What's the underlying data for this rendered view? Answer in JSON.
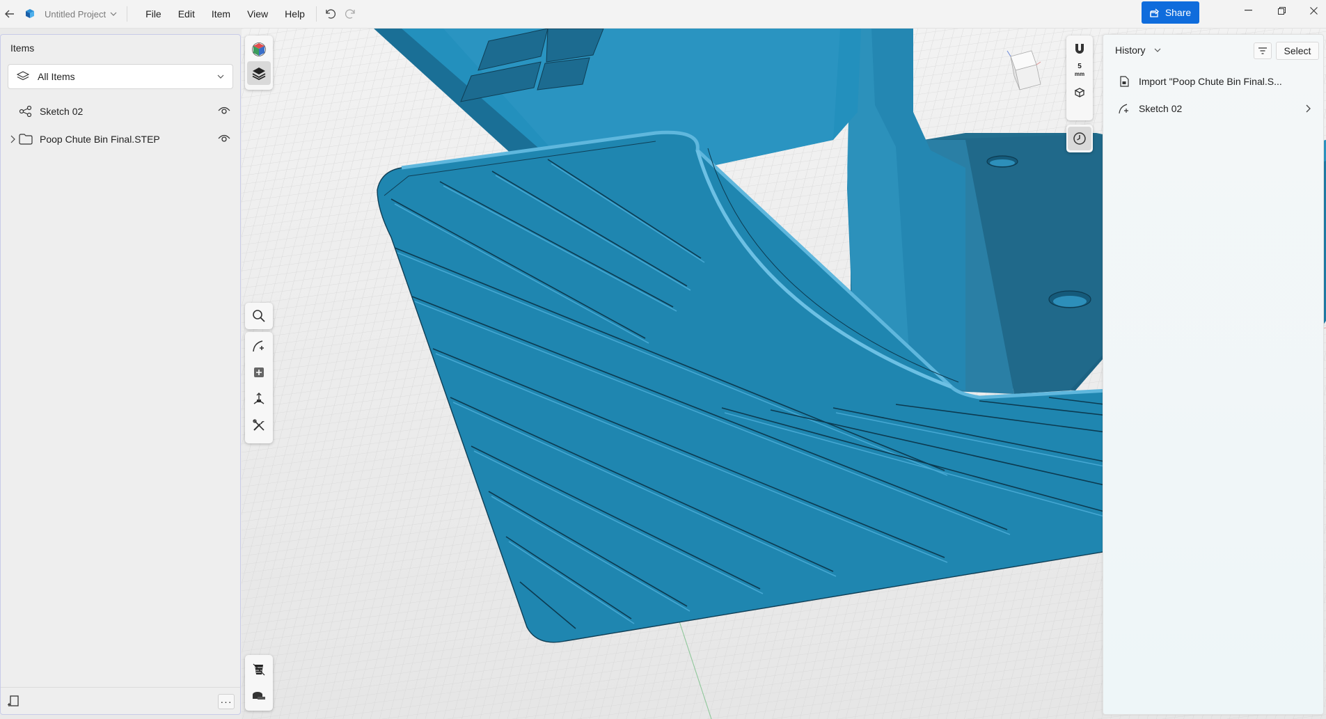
{
  "titlebar": {
    "project_name": "Untitled Project",
    "menu": [
      "File",
      "Edit",
      "Item",
      "View",
      "Help"
    ],
    "share_label": "Share",
    "accent": "#0f6cdc"
  },
  "items_panel": {
    "title": "Items",
    "filter_value": "All Items",
    "tree": [
      {
        "label": "Sketch 02",
        "icon": "sketch-icon"
      },
      {
        "label": "Poop Chute Bin Final.STEP",
        "icon": "folder-icon"
      }
    ],
    "more_label": "···"
  },
  "viewport": {
    "scale_value": "5",
    "scale_unit": "mm",
    "model_color": "#1f86b0"
  },
  "history_panel": {
    "title": "History",
    "select_label": "Select",
    "entries": [
      {
        "label": "Import \"Poop Chute Bin Final.S...",
        "icon": "import-icon"
      },
      {
        "label": "Sketch 02",
        "icon": "sketch-icon"
      }
    ]
  }
}
